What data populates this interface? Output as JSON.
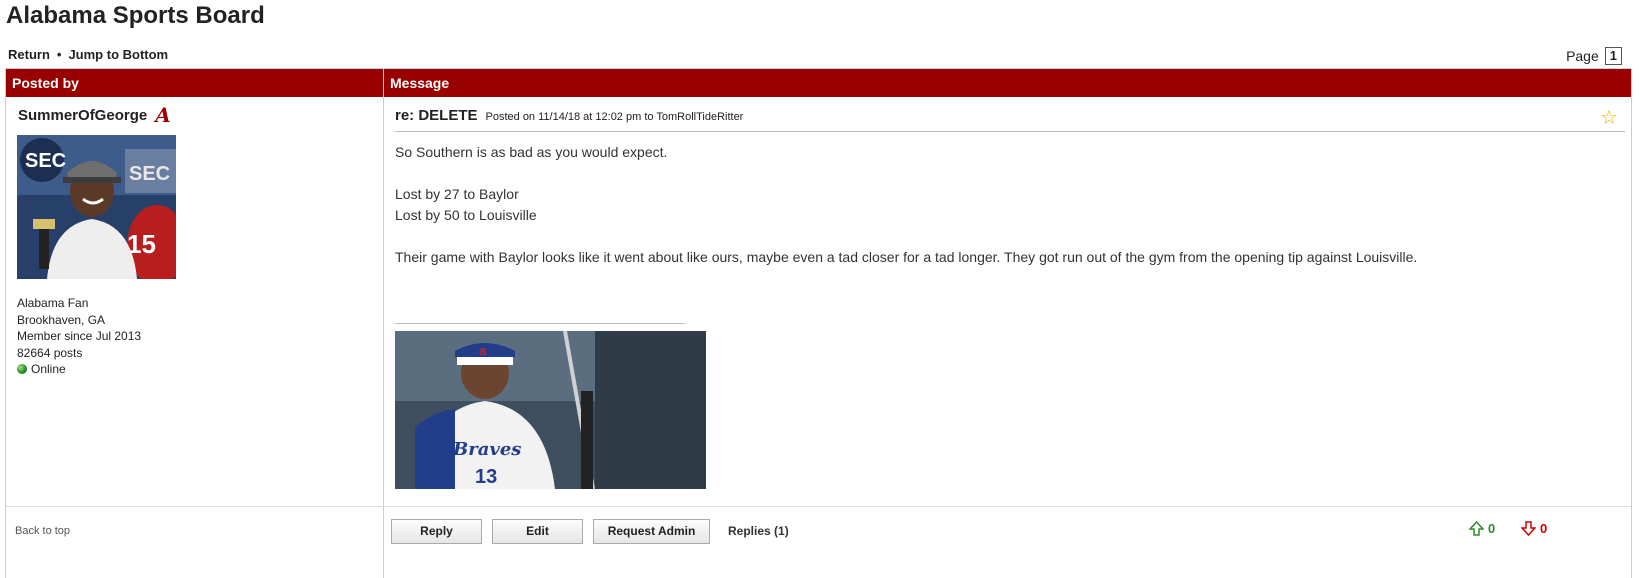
{
  "board": {
    "title": "Alabama Sports Board"
  },
  "nav": {
    "return": "Return",
    "separator": "•",
    "jump": "Jump to Bottom"
  },
  "pager": {
    "label": "Page",
    "current": "1"
  },
  "table": {
    "col_posted_by": "Posted by",
    "col_message": "Message"
  },
  "author": {
    "name": "SummerOfGeorge",
    "team_icon": "alabama-a-icon",
    "fan_of": "Alabama Fan",
    "location": "Brookhaven, GA",
    "member_since": "Member since Jul 2013",
    "posts": "82664 posts",
    "status": "Online"
  },
  "post": {
    "subject": "re: DELETE",
    "posted_on": "Posted on 11/14/18 at 12:02 pm to TomRollTideRitter",
    "line1": "So Southern is as bad as you would expect.",
    "line2": "Lost by 27 to Baylor",
    "line3": "Lost by 50 to Louisville",
    "line4": "Their game with Baylor looks like it went about like ours, maybe even a tad closer for a tad longer. They got run out of the gym from the opening tip against Louisville.",
    "star_icon": "star-icon"
  },
  "footer": {
    "back_to_top": "Back to top",
    "reply": "Reply",
    "edit": "Edit",
    "request_admin": "Request Admin",
    "replies": "Replies (1)",
    "upvotes": "0",
    "downvotes": "0"
  },
  "colors": {
    "header_bg": "#990000",
    "star": "#f0b000",
    "up": "#2a8a2a",
    "down": "#cc0000"
  }
}
